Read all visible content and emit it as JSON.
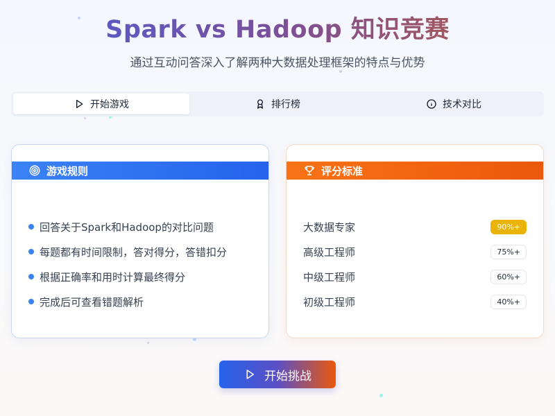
{
  "header": {
    "title": "Spark vs Hadoop 知识竞赛",
    "subtitle": "通过互动问答深入了解两种大数据处理框架的特点与优势"
  },
  "tabs": [
    {
      "label": "开始游戏",
      "icon": "play-icon",
      "active": true
    },
    {
      "label": "排行榜",
      "icon": "award-icon",
      "active": false
    },
    {
      "label": "技术对比",
      "icon": "info-icon",
      "active": false
    }
  ],
  "rules_card": {
    "title": "游戏规则",
    "icon": "target-icon",
    "items": [
      "回答关于Spark和Hadoop的对比问题",
      "每题都有时间限制，答对得分，答错扣分",
      "根据正确率和用时计算最终得分",
      "完成后可查看错题解析"
    ]
  },
  "scoring_card": {
    "title": "评分标准",
    "icon": "trophy-icon",
    "levels": [
      {
        "name": "大数据专家",
        "threshold": "90%+"
      },
      {
        "name": "高级工程师",
        "threshold": "75%+"
      },
      {
        "name": "中级工程师",
        "threshold": "60%+"
      },
      {
        "name": "初级工程师",
        "threshold": "40%+"
      }
    ]
  },
  "start_button": {
    "label": "开始挑战",
    "icon": "play-icon"
  },
  "colors": {
    "blue_accent": "#2563eb",
    "orange_accent": "#ea580c",
    "gold_badge": "#eab308"
  }
}
